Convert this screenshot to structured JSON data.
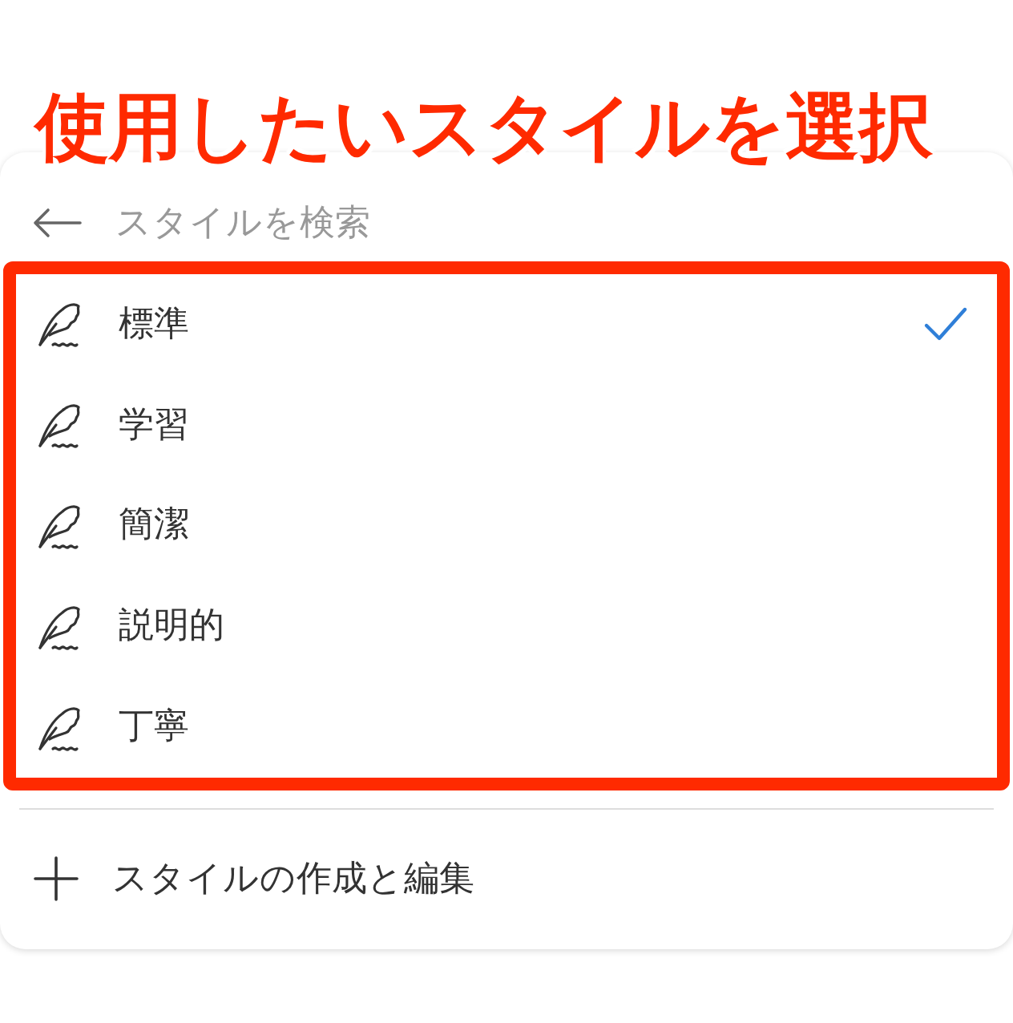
{
  "annotation": "使用したいスタイルを選択",
  "search": {
    "placeholder": "スタイルを検索"
  },
  "styles": [
    {
      "label": "標準",
      "selected": true
    },
    {
      "label": "学習",
      "selected": false
    },
    {
      "label": "簡潔",
      "selected": false
    },
    {
      "label": "説明的",
      "selected": false
    },
    {
      "label": "丁寧",
      "selected": false
    }
  ],
  "create_action": "スタイルの作成と編集"
}
